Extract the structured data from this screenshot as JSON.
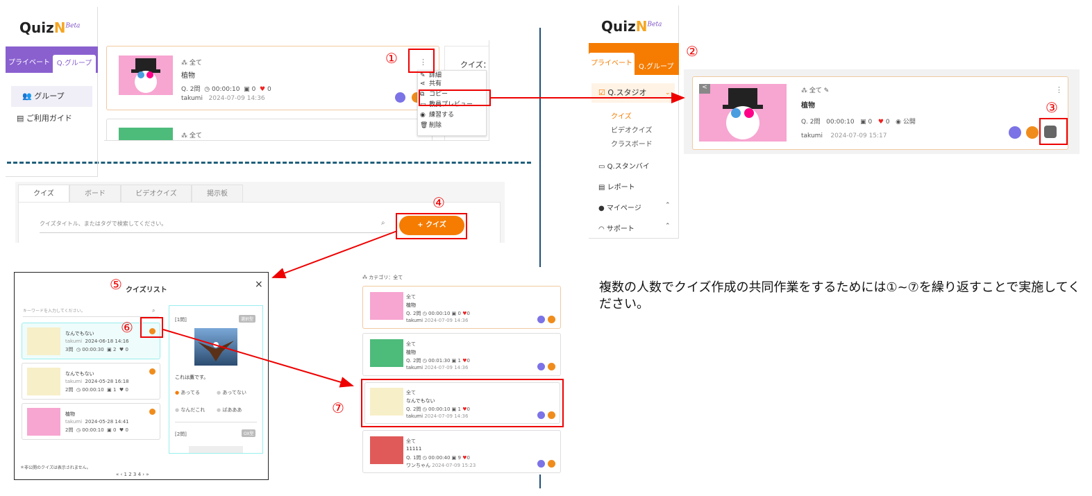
{
  "brand": {
    "name": "Quiz",
    "n": "N",
    "beta": "Beta"
  },
  "tabs": {
    "private": "プライベート",
    "group": "Q.グループ"
  },
  "left_sidebar": {
    "group": "グループ",
    "guide": "ご利用ガイド"
  },
  "card_top": {
    "tag": "全て",
    "title": "植物",
    "questions": "Q. 2問",
    "time": "00:00:10",
    "plays": "0",
    "likes": "0",
    "author": "takumi",
    "date": "2024-07-09 14:36"
  },
  "card_top2": {
    "tag": "全て"
  },
  "partial_header": "クイズ：",
  "context_menu": {
    "items": [
      "詳細",
      "共有",
      "コピー",
      "教員プレビュー",
      "練習する",
      "削除"
    ]
  },
  "callouts": {
    "c1": "①",
    "c2": "②",
    "c3": "③",
    "c4": "④",
    "c5": "⑤",
    "c6": "⑥",
    "c7": "⑦"
  },
  "right_sidebar": {
    "studio": "Q.スタジオ",
    "quiz": "クイズ",
    "video": "ビデオクイズ",
    "board": "クラスボード",
    "standby": "Q.スタンバイ",
    "report": "レポート",
    "mypage": "マイページ",
    "support": "サポート"
  },
  "copied_card": {
    "tag": "全て",
    "title": "植物",
    "questions": "Q. 2問",
    "time": "00:00:10",
    "plays": "0",
    "likes": "0",
    "visibility": "公開",
    "author": "takumi",
    "date": "2024-07-09 15:17"
  },
  "search_panel": {
    "tabs": [
      "クイズ",
      "ボード",
      "ビデオクイズ",
      "掲示板"
    ],
    "placeholder": "クイズタイトル、またはタグで検索してください。",
    "add_button": "+ クイズ"
  },
  "modal": {
    "title": "クイズリスト",
    "search_placeholder": "キーワードを入力してください。",
    "items": [
      {
        "title": "なんでもない",
        "author": "takumi",
        "date": "2024-06-18 14:16",
        "q": "3問",
        "time": "00:00:30",
        "plays": "2",
        "likes": "0"
      },
      {
        "title": "なんでもない",
        "author": "takumi",
        "date": "2024-05-28 16:18",
        "q": "2問",
        "time": "00:00:10",
        "plays": "1",
        "likes": "0"
      },
      {
        "title": "植物",
        "author": "takumi",
        "date": "2024-05-28 14:41",
        "q": "2問",
        "time": "00:00:10",
        "plays": "0",
        "likes": "0"
      }
    ],
    "preview": {
      "q1": "[1問]",
      "badge1": "選択型",
      "question": "これは鷹です。",
      "options": [
        "あってる",
        "あってない",
        "なんだこれ",
        "ばあああ"
      ],
      "q2": "[2問]",
      "badge2": "OX型"
    },
    "footnote": "＊非公開のクイズは表示されません。",
    "pager": "« ‹ 1 2 3 4 › »"
  },
  "list_panel": {
    "category": "カテゴリ：全て",
    "cards": [
      {
        "tag": "全て",
        "title": "植物",
        "q": "Q. 2問",
        "time": "00:00:10",
        "plays": "0",
        "likes": "0",
        "author": "takumi",
        "date": "2024-07-09 14:36"
      },
      {
        "tag": "全て",
        "title": "植物",
        "q": "Q. 2問",
        "time": "00:01:30",
        "plays": "1",
        "likes": "0",
        "author": "takumi",
        "date": "2024-07-09 14:36"
      },
      {
        "tag": "全て",
        "title": "なんでもない",
        "q": "Q. 2問",
        "time": "00:00:10",
        "plays": "1",
        "likes": "0",
        "author": "takumi",
        "date": "2024-07-09 14:36"
      },
      {
        "tag": "全て",
        "title": "11111",
        "q": "Q. 1問",
        "time": "00:00:40",
        "plays": "9",
        "likes": "0",
        "author": "ワンちゃん",
        "date": "2024-07-09 15:23"
      }
    ]
  },
  "instruction": "複数の人数でクイズ作成の共同作業をするためには①~⑦を繰り返すことで実施してください。",
  "colors": {
    "purple": "#8a60cf",
    "orange": "#f57c00",
    "red_annotation": "#ee0000",
    "divider": "#1f4e79"
  }
}
